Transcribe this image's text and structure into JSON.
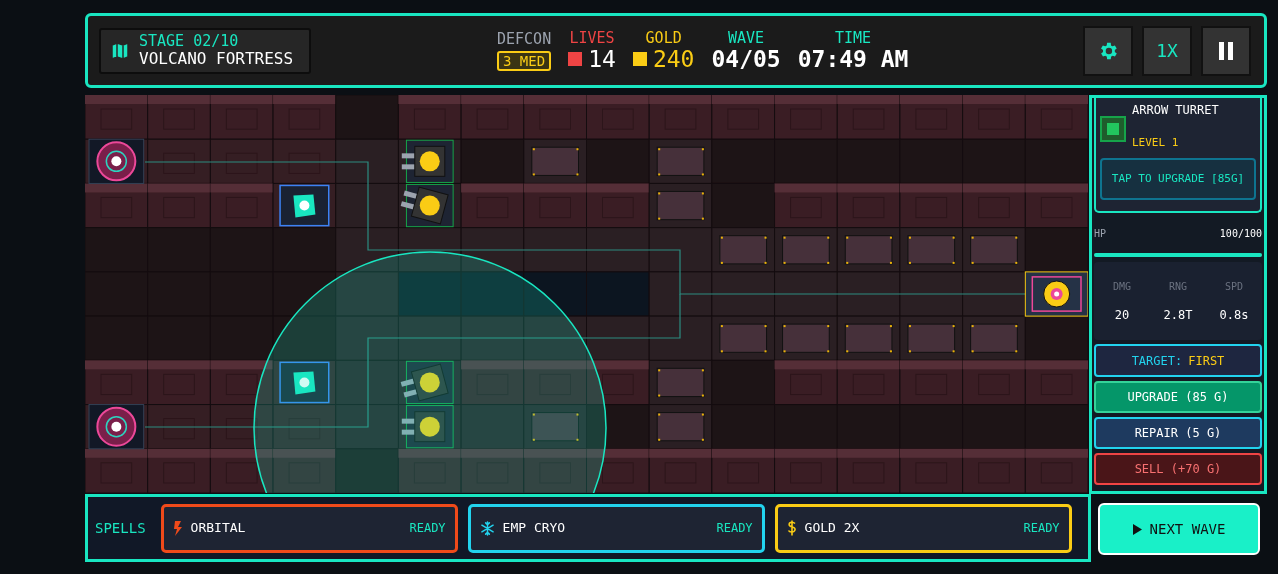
{
  "header": {
    "stage": "STAGE 02/10",
    "map_name": "VOLCANO FORTRESS",
    "stats": [
      {
        "kind": "defcon",
        "label": "DEFCON",
        "value": "3 MED"
      },
      {
        "kind": "lives",
        "label": "LIVES",
        "value": "14"
      },
      {
        "kind": "gold",
        "label": "GOLD",
        "value": "240"
      },
      {
        "kind": "wave",
        "label": "WAVE",
        "value": "04/05"
      },
      {
        "kind": "time",
        "label": "TIME",
        "value": "07:49 AM"
      }
    ],
    "buttons": [
      {
        "kind": "settings"
      },
      {
        "kind": "speed",
        "label": "1X"
      },
      {
        "kind": "pause"
      }
    ]
  },
  "tower_panel": {
    "name": "ARROW TURRET",
    "level_label": "LEVEL 1",
    "upgrade_hint": "TAP TO UPGRADE [85G]",
    "hp": {
      "label": "HP",
      "reading": "100/100",
      "level": 1
    },
    "stats": [
      {
        "label": "DMG",
        "value": "20"
      },
      {
        "label": "RNG",
        "value": "2.8T"
      },
      {
        "label": "SPD",
        "value": "0.8s"
      }
    ],
    "target": {
      "label": "TARGET:",
      "value": "FIRST"
    },
    "actions": [
      {
        "kind": "upgrade",
        "label": "UPGRADE (85 G)"
      },
      {
        "kind": "repair",
        "label": "REPAIR (5 G)"
      },
      {
        "kind": "sell",
        "label": "SELL (+70 G)"
      }
    ]
  },
  "spells": {
    "label": "SPELLS",
    "items": [
      {
        "kind": "orbital",
        "name": "ORBITAL",
        "status": "READY",
        "color": "#f04a1a"
      },
      {
        "kind": "cryo",
        "name": "EMP CRYO",
        "status": "READY",
        "color": "#22d3ee"
      },
      {
        "kind": "gold",
        "name": "GOLD 2X",
        "status": "READY",
        "color": "#facc15"
      }
    ]
  },
  "next_wave": {
    "label": "NEXT WAVE"
  }
}
